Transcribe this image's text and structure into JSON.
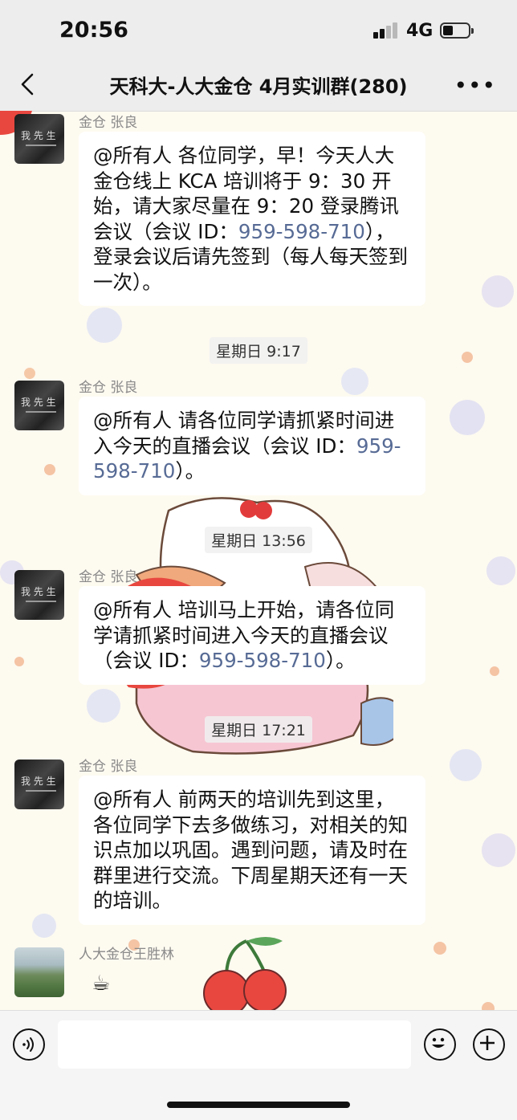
{
  "status_bar": {
    "time": "20:56",
    "network": "4G"
  },
  "nav": {
    "title": "天科大-人大金仓 4月实训群(280)"
  },
  "messages": [
    {
      "sender": "金仓 张良",
      "text_a": "@所有人 各位同学，早！今天人大金仓线上 KCA 培训将于 9：30 开始，请大家尽量在 9：20 登录腾讯会议（会议 ID：",
      "id": "959-598-710",
      "text_b": "），登录会议后请先签到（每人每天签到一次）。"
    },
    {
      "timestamp": "星期日 9:17",
      "sender": "金仓 张良",
      "text_a": "@所有人 请各位同学请抓紧时间进入今天的直播会议（会议 ID：",
      "id": "959-598-710",
      "text_b": "）。"
    },
    {
      "timestamp": "星期日 13:56",
      "sender": "金仓 张良",
      "text_a": "@所有人 培训马上开始，请各位同学请抓紧时间进入今天的直播会议（会议 ID：",
      "id": "959-598-710",
      "text_b": "）。"
    },
    {
      "timestamp": "星期日 17:21",
      "sender": "金仓 张良",
      "text_a": "@所有人 前两天的培训先到这里，各位同学下去多做练习，对相关的知识点加以巩固。遇到问题，请及时在群里进行交流。下周星期天还有一天的培训。"
    },
    {
      "sender": "人大金仓王胜林",
      "text_a": "☕"
    }
  ],
  "colors": {
    "link": "#576b95",
    "chrome": "#ededed"
  }
}
